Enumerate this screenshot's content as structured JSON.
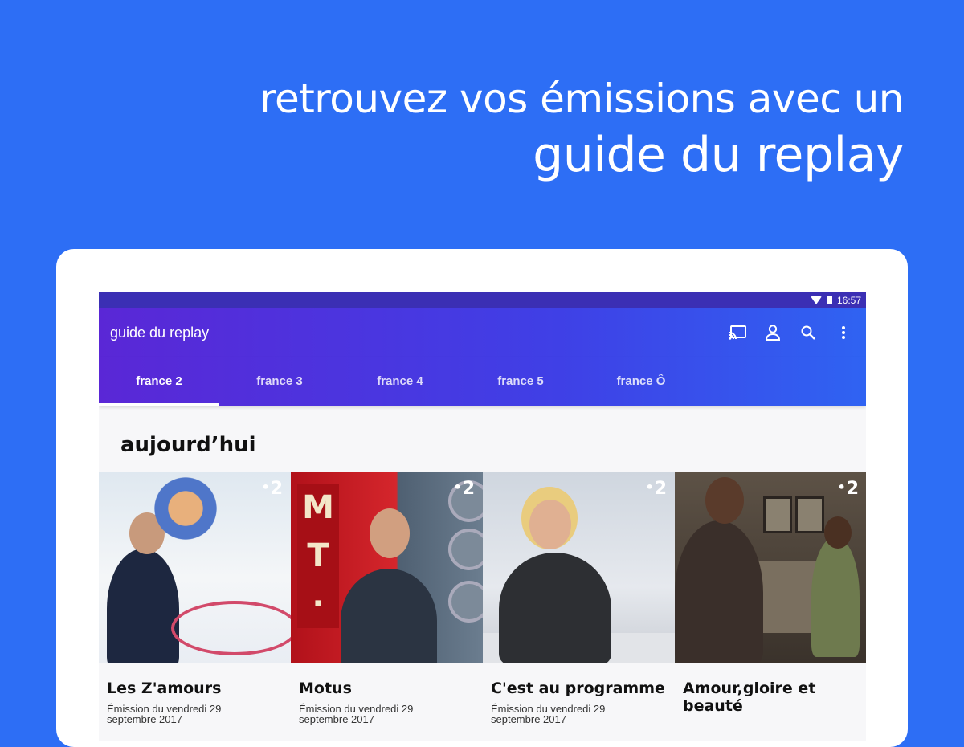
{
  "headline": {
    "line1": "retrouvez vos émissions avec un",
    "line2": "guide du replay"
  },
  "status_bar": {
    "time": "16:57"
  },
  "app_bar": {
    "title": "guide du replay",
    "icons": [
      "cast-icon",
      "account-icon",
      "search-icon",
      "more-vert-icon"
    ]
  },
  "tabs": [
    {
      "label": "france 2",
      "active": true
    },
    {
      "label": "france 3",
      "active": false
    },
    {
      "label": "france 4",
      "active": false
    },
    {
      "label": "france 5",
      "active": false
    },
    {
      "label": "france Ô",
      "active": false
    }
  ],
  "section": {
    "title": "aujourd’hui"
  },
  "programs": [
    {
      "title": "Les Z'amours",
      "subtitle_1": "Émission du vendredi 29",
      "subtitle_2": "septembre 2017",
      "channel_badge": "2"
    },
    {
      "title": "Motus",
      "subtitle_1": "Émission du vendredi 29",
      "subtitle_2": "septembre 2017",
      "channel_badge": "2"
    },
    {
      "title": "C'est au programme",
      "subtitle_1": "Émission du vendredi 29",
      "subtitle_2": "septembre 2017",
      "channel_badge": "2"
    },
    {
      "title": "Amour,gloire et beauté",
      "subtitle_1": "",
      "subtitle_2": "",
      "channel_badge": "2"
    }
  ],
  "colors": {
    "background": "#2d6ef5",
    "app_bar_start": "#5a27d6",
    "app_bar_end": "#2f63f2",
    "status_bar": "#3b2fb4"
  }
}
